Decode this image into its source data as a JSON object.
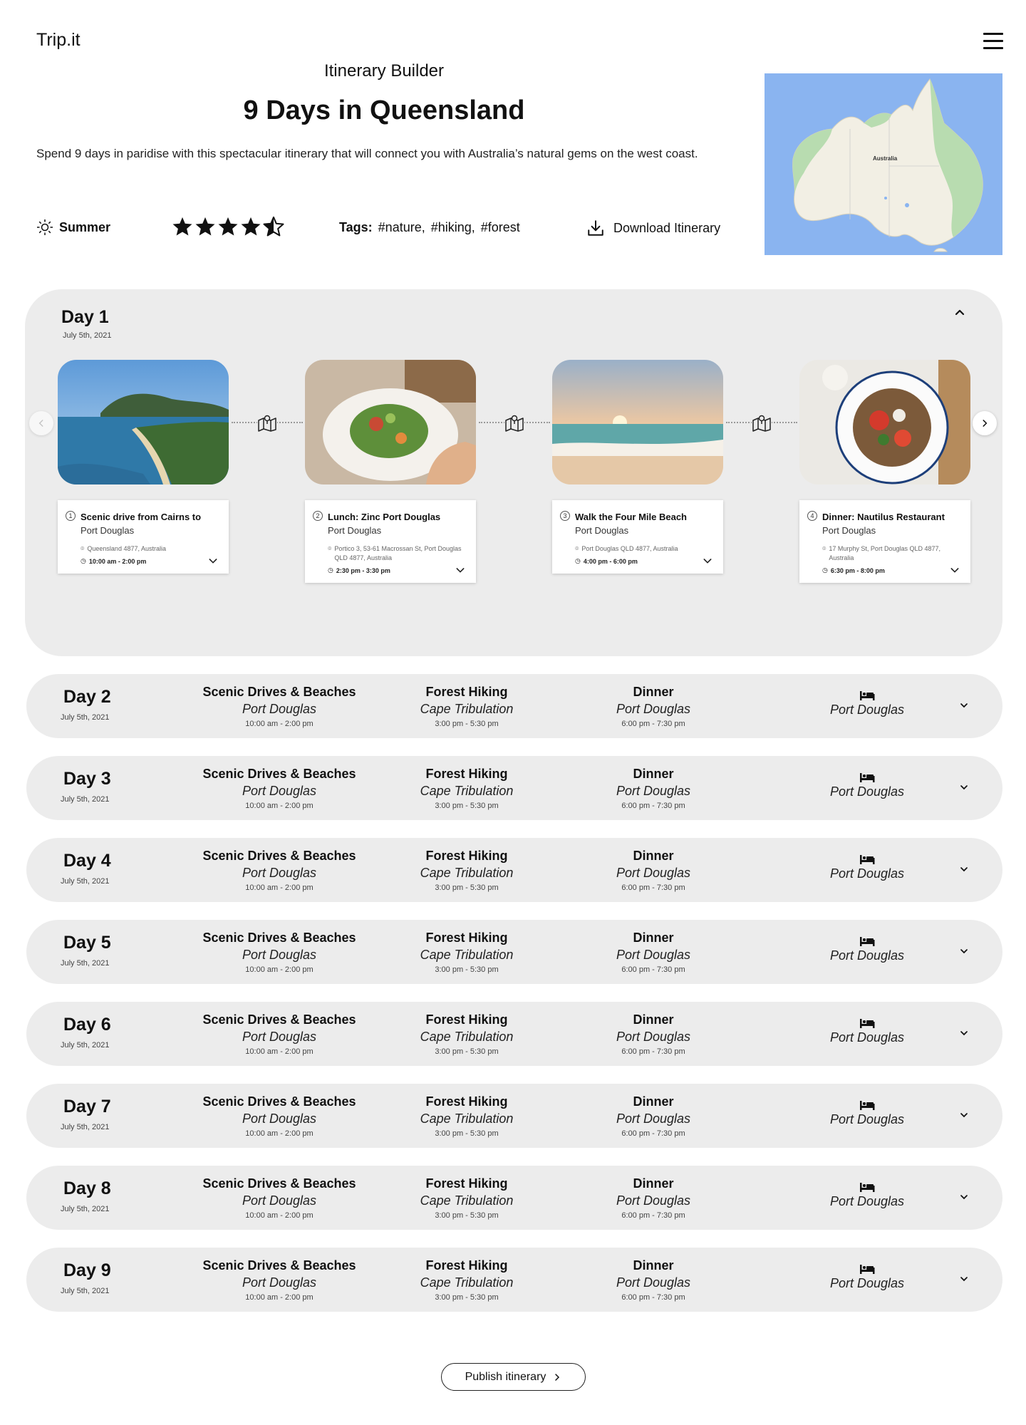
{
  "app": {
    "logo": "Trip.it"
  },
  "header": {
    "subtitle": "Itinerary Builder",
    "title": "9 Days in Queensland",
    "description": "Spend 9 days in paridise with this spectacular itinerary that will connect you with Australia’s natural gems on the west coast.",
    "season": "Summer",
    "rating": 4.5,
    "tags_label": "Tags:",
    "tags": [
      "#nature,",
      "#hiking,",
      "#forest"
    ],
    "download_label": "Download Itinerary",
    "map_label": "Australia"
  },
  "day1": {
    "title": "Day 1",
    "date": "July 5th, 2021",
    "activities": [
      {
        "num": "1",
        "name": "Scenic drive from Cairns to",
        "place": "Port Douglas",
        "address": "Queensland 4877, Australia",
        "time": "10:00 am - 2:00 pm"
      },
      {
        "num": "2",
        "name": "Lunch: Zinc Port Douglas",
        "place": "Port Douglas",
        "address": "Portico 3, 53-61 Macrossan St, Port Douglas QLD 4877, Australia",
        "time": "2:30 pm - 3:30 pm"
      },
      {
        "num": "3",
        "name": "Walk the Four Mile Beach",
        "place": "Port Douglas",
        "address": "Port Douglas QLD 4877, Australia",
        "time": "4:00 pm - 6:00 pm"
      },
      {
        "num": "4",
        "name": "Dinner: Nautilus Restaurant",
        "place": "Port Douglas",
        "address": "17 Murphy St, Port Douglas QLD 4877, Australia",
        "time": "6:30 pm - 8:00 pm"
      }
    ]
  },
  "days": [
    {
      "title": "Day 2",
      "date": "July 5th, 2021"
    },
    {
      "title": "Day 3",
      "date": "July 5th, 2021"
    },
    {
      "title": "Day 4",
      "date": "July 5th, 2021"
    },
    {
      "title": "Day 5",
      "date": "July 5th, 2021"
    },
    {
      "title": "Day 6",
      "date": "July 5th, 2021"
    },
    {
      "title": "Day 7",
      "date": "July 5th, 2021"
    },
    {
      "title": "Day 8",
      "date": "July 5th, 2021"
    },
    {
      "title": "Day 9",
      "date": "July 5th, 2021"
    }
  ],
  "day_summary": {
    "a1": {
      "name": "Scenic Drives & Beaches",
      "place": "Port Douglas",
      "time": "10:00 am - 2:00 pm"
    },
    "a2": {
      "name": "Forest Hiking",
      "place": "Cape Tribulation",
      "time": "3:00 pm - 5:30 pm"
    },
    "a3": {
      "name": "Dinner",
      "place": "Port Douglas",
      "time": "6:00 pm - 7:30 pm"
    },
    "stay": "Port Douglas"
  },
  "publish_label": "Publish itinerary",
  "colors": {
    "panel": "#ececec",
    "map_water": "#8ab4f0",
    "map_land": "#f2efe4",
    "map_green": "#b8dcb0"
  },
  "icons": [
    "menu-icon",
    "sun-icon",
    "star-icon",
    "star-half-icon",
    "download-icon",
    "chevron-up-icon",
    "chevron-down-icon",
    "chevron-left-icon",
    "chevron-right-icon",
    "map-icon",
    "pin-icon",
    "clock-icon",
    "bed-icon"
  ]
}
